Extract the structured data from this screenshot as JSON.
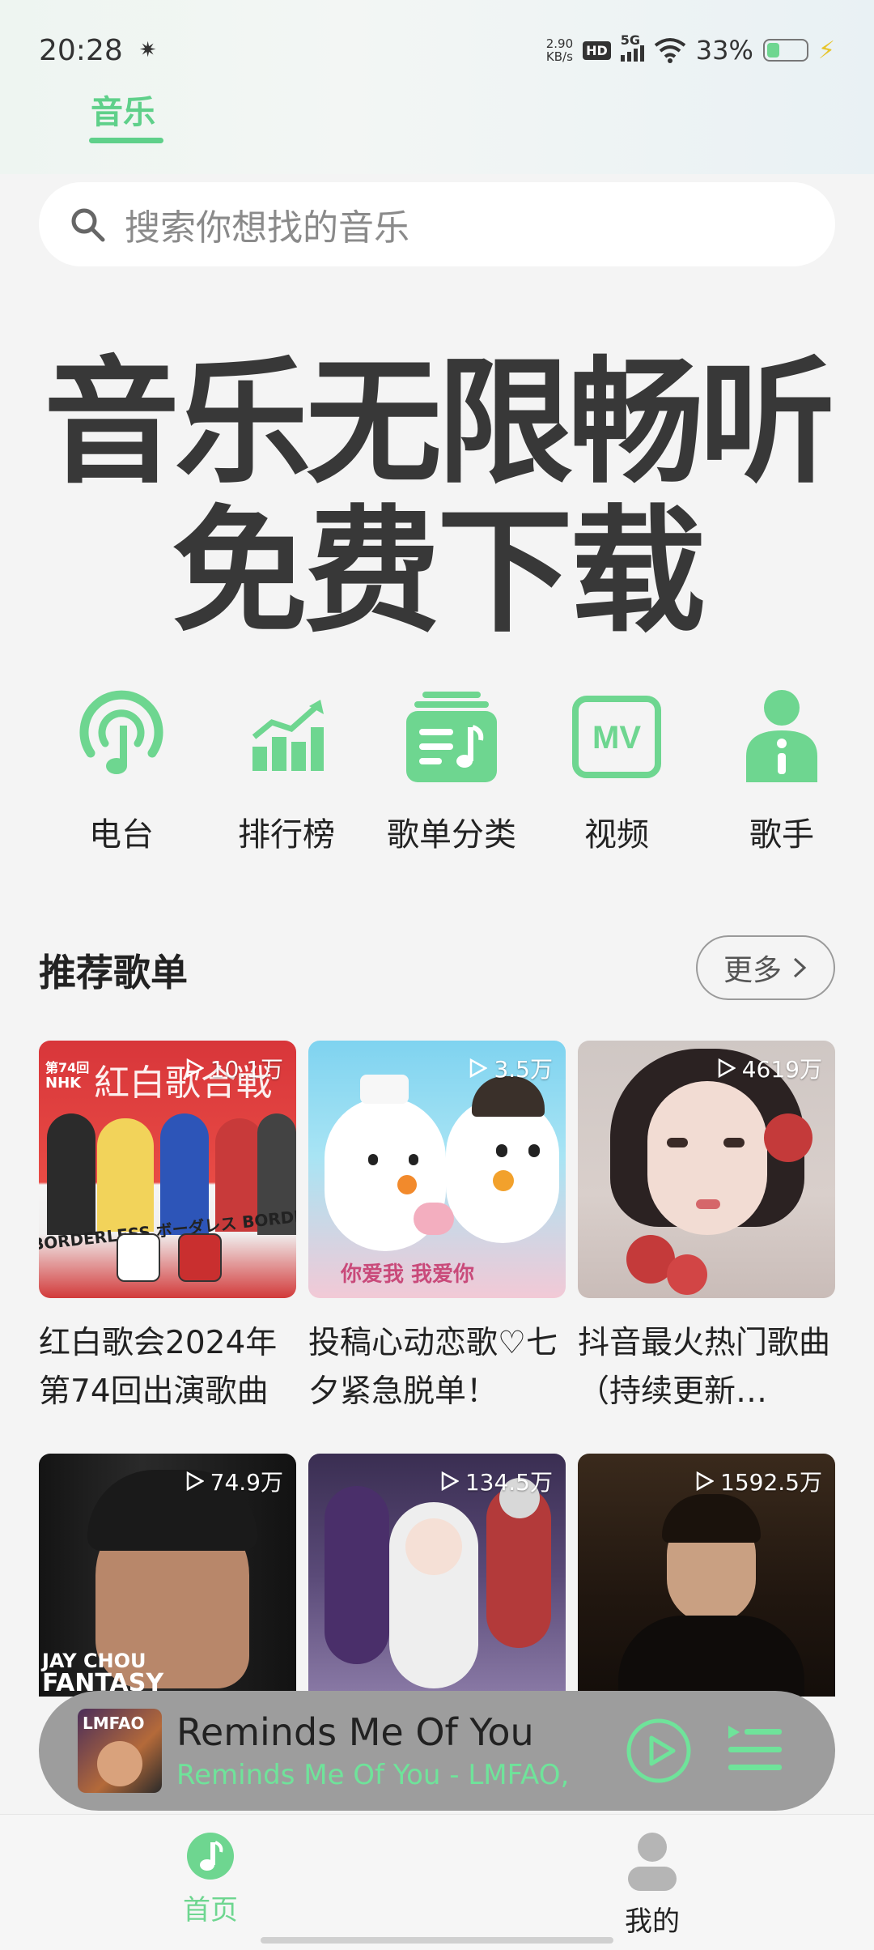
{
  "status_bar": {
    "time": "20:28",
    "net_speed_value": "2.90",
    "net_speed_unit": "KB/s",
    "hd": "HD",
    "network": "5G",
    "battery": "33%",
    "battery_level": 0.33
  },
  "header": {
    "tab_label": "音乐"
  },
  "search": {
    "placeholder": "搜索你想找的音乐"
  },
  "banner": {
    "line1": "音乐无限畅听",
    "line2": "免费下载"
  },
  "categories": [
    {
      "label": "电台",
      "icon": "radio-icon"
    },
    {
      "label": "排行榜",
      "icon": "chart-icon"
    },
    {
      "label": "歌单分类",
      "icon": "playlist-category-icon"
    },
    {
      "label": "视频",
      "icon": "mv-icon"
    },
    {
      "label": "歌手",
      "icon": "singer-icon"
    }
  ],
  "recommend": {
    "title": "推荐歌单",
    "more_label": "更多"
  },
  "playlists": [
    {
      "title": "红白歌会2024年第74回出演歌曲",
      "plays": "10.1万"
    },
    {
      "title": "投稿心动恋歌♡七夕紧急脱单！",
      "plays": "3.5万"
    },
    {
      "title": "抖音最火热门歌曲（持续更新…",
      "plays": "4619万"
    },
    {
      "title": "",
      "plays": "74.9万"
    },
    {
      "title": "",
      "plays": "134.5万"
    },
    {
      "title": "",
      "plays": "1592.5万"
    }
  ],
  "cover_text": {
    "c1_top": "紅白歌合戦",
    "c1_nhk": "NHK",
    "c1_74": "第74回",
    "c1_band": "BORDERLESS ボーダレス BORDERLESS",
    "c2_caption": "你爱我 我爱你",
    "c4_caption1": "JAY CHOU",
    "c4_caption2": "FANTASY"
  },
  "player": {
    "song": "Reminds Me Of You",
    "artist": "Reminds Me Of You - LMFAO,",
    "art_label": "LMFAO"
  },
  "bottom_nav": [
    {
      "label": "首页"
    },
    {
      "label": "我的"
    }
  ],
  "colors": {
    "accent": "#5fd08a",
    "text": "#222222",
    "player_bg": "#9d9d9d"
  }
}
